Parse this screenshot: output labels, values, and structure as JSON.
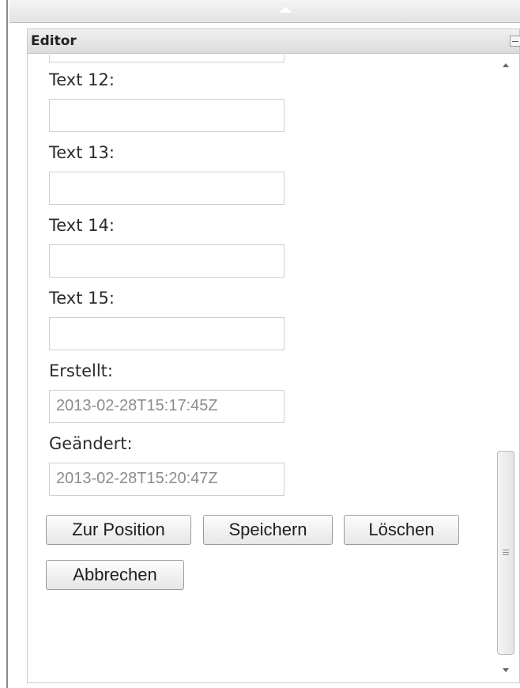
{
  "panel": {
    "title": "Editor"
  },
  "fields": {
    "text12": {
      "label": "Text 12:",
      "value": ""
    },
    "text13": {
      "label": "Text 13:",
      "value": ""
    },
    "text14": {
      "label": "Text 14:",
      "value": ""
    },
    "text15": {
      "label": "Text 15:",
      "value": ""
    },
    "created": {
      "label": "Erstellt:",
      "value": "2013-02-28T15:17:45Z"
    },
    "changed": {
      "label": "Geändert:",
      "value": "2013-02-28T15:20:47Z"
    }
  },
  "buttons": {
    "to_position": "Zur Position",
    "save": "Speichern",
    "delete": "Löschen",
    "cancel": "Abbrechen"
  },
  "icons": {
    "splitter": "chevron-up-icon",
    "collapse": "minimize-icon",
    "scroll_up": "arrow-up-icon",
    "scroll_down": "arrow-down-icon",
    "grip": "grip-icon"
  }
}
